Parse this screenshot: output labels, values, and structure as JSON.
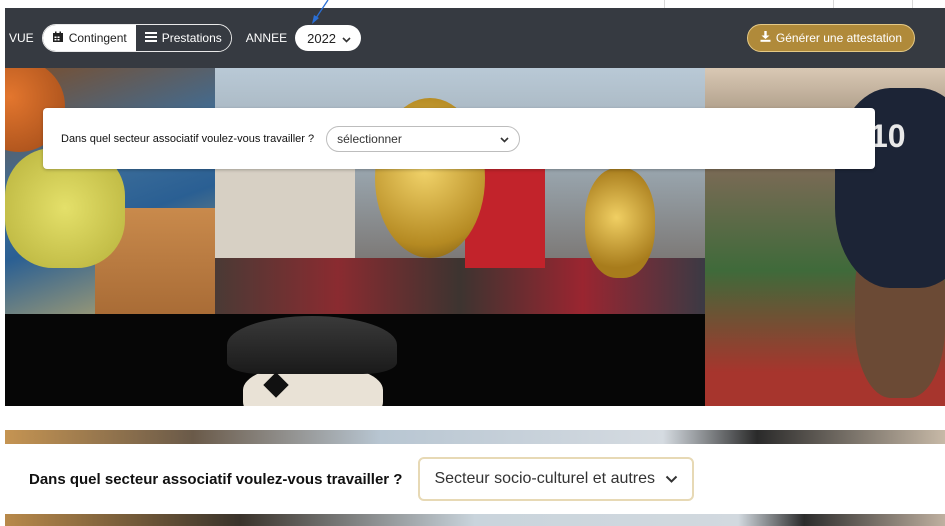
{
  "toolbar": {
    "vue_label": "VUE",
    "view_options": [
      "Contingent",
      "Prestations"
    ],
    "active_view": "Contingent",
    "annee_label": "ANNEE",
    "year_value": "2022",
    "generate_button": "Générer une attestation",
    "accent_color": "#b08a3a"
  },
  "card": {
    "question": "Dans quel secteur associatif voulez-vous travailler ?",
    "select_value": "sélectionner"
  },
  "zoom": {
    "question": "Dans quel secteur associatif voulez-vous travailler ?",
    "select_value": "Secteur socio-culturel et autres"
  },
  "icons": [
    "calendar-icon",
    "list-icon",
    "chevron-down-icon",
    "download-icon"
  ],
  "hero": {
    "jersey_number": "10"
  }
}
